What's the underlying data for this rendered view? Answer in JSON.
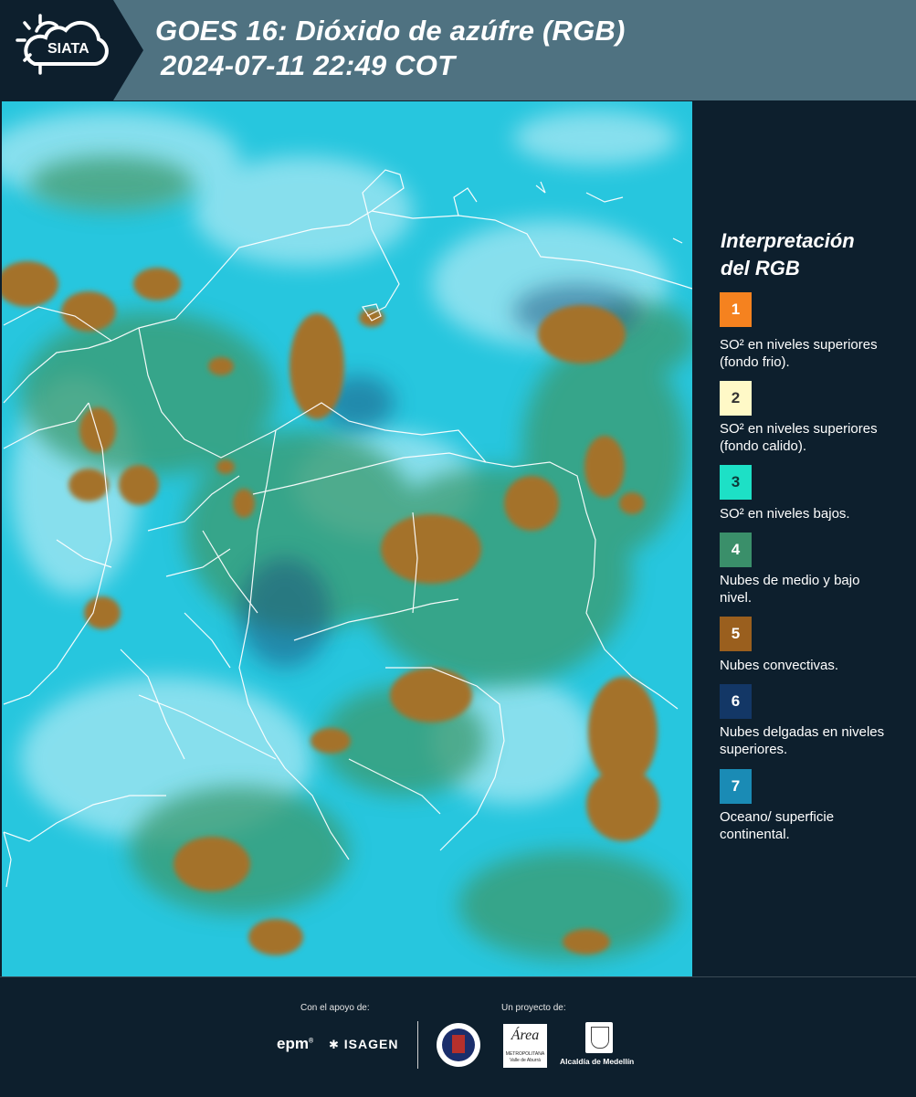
{
  "header": {
    "logo_text": "SIATA",
    "title_line1": "GOES 16: Dióxido de azúfre (RGB)",
    "title_line2": "2024-07-11 22:49 COT"
  },
  "legend": {
    "title_line1": "Interpretación",
    "title_line2": "del RGB",
    "items": [
      {
        "number": "1",
        "color": "#f5821f",
        "text_color": "#ffffff",
        "label": "SO² en niveles superiores (fondo frio)."
      },
      {
        "number": "2",
        "color": "#fff9c7",
        "text_color": "#333333",
        "label": "SO² en niveles superiores (fondo calido)."
      },
      {
        "number": "3",
        "color": "#1de0c6",
        "text_color": "#0d3a3a",
        "label": "SO² en niveles bajos."
      },
      {
        "number": "4",
        "color": "#3a8f6a",
        "text_color": "#ffffff",
        "label": "Nubes de medio y bajo nivel."
      },
      {
        "number": "5",
        "color": "#9a5f1e",
        "text_color": "#ffffff",
        "label": "Nubes convectivas."
      },
      {
        "number": "6",
        "color": "#133766",
        "text_color": "#ffffff",
        "label": "Nubes delgadas en niveles superiores."
      },
      {
        "number": "7",
        "color": "#1a8bb5",
        "text_color": "#ffffff",
        "label": "Oceano/ superficie continental."
      }
    ]
  },
  "footer": {
    "support_caption": "Con el apoyo de:",
    "project_caption": "Un proyecto de:",
    "sponsor_epm": "epm",
    "sponsor_isagen": "ISAGEN",
    "area_logo_word": "Área",
    "area_logo_sub1": "METROPOLITANA",
    "area_logo_sub2": "Valle de Aburrá",
    "alcaldia_label": "Alcaldía de Medellín"
  }
}
